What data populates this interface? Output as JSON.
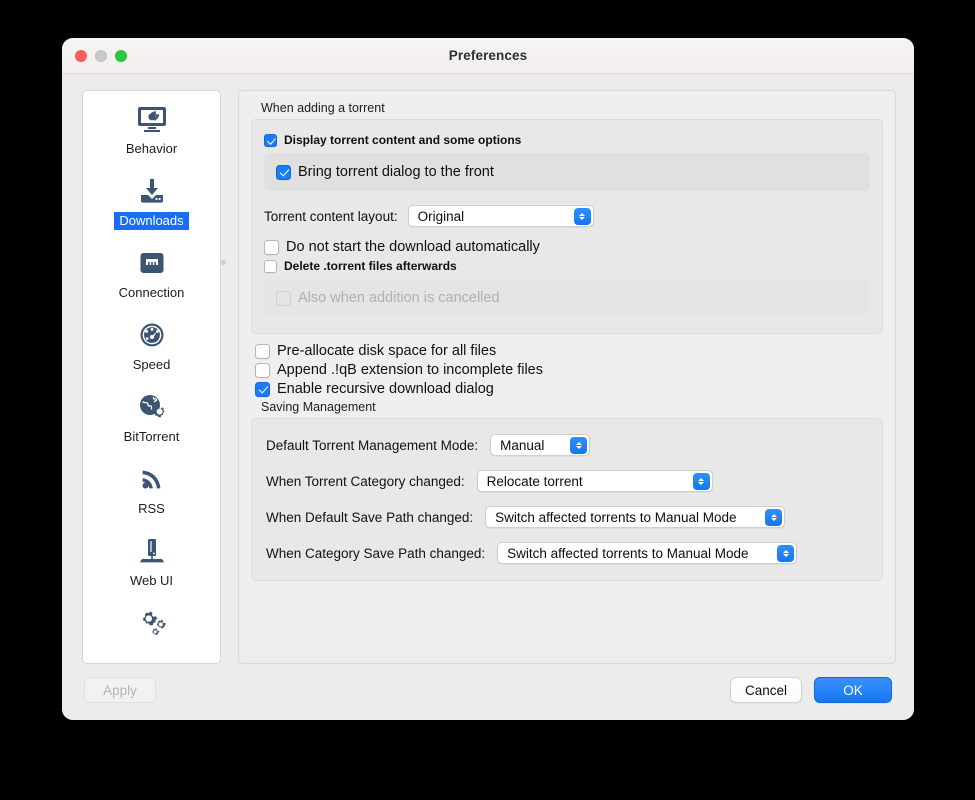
{
  "window": {
    "title": "Preferences",
    "traffic_lights": [
      "close-red",
      "minimize-gray",
      "zoom-green"
    ]
  },
  "sidebar": {
    "items": [
      {
        "label": "Behavior",
        "icon": "monitor-gear-icon",
        "selected": false
      },
      {
        "label": "Downloads",
        "icon": "download-arrow-icon",
        "selected": true
      },
      {
        "label": "Connection",
        "icon": "ethernet-port-icon",
        "selected": false
      },
      {
        "label": "Speed",
        "icon": "speedometer-icon",
        "selected": false
      },
      {
        "label": "BitTorrent",
        "icon": "globe-gear-icon",
        "selected": false
      },
      {
        "label": "RSS",
        "icon": "rss-waves-icon",
        "selected": false
      },
      {
        "label": "Web UI",
        "icon": "server-rack-icon",
        "selected": false
      },
      {
        "label": "",
        "icon": "gears-icon",
        "selected": false
      }
    ]
  },
  "content": {
    "adding_group": {
      "title": "When adding a torrent",
      "display_content": {
        "label": "Display torrent content and some options",
        "checked": true
      },
      "bring_front": {
        "label": "Bring torrent dialog to the front",
        "checked": true
      },
      "layout": {
        "label": "Torrent content layout:",
        "value": "Original"
      },
      "do_not_start": {
        "label": "Do not start the download automatically",
        "checked": false
      },
      "delete_torrent": {
        "label": "Delete .torrent files afterwards",
        "checked": false
      },
      "also_cancelled": {
        "label": "Also when addition is cancelled",
        "checked": false,
        "disabled": true
      }
    },
    "standalone_checkboxes": [
      {
        "label": "Pre-allocate disk space for all files",
        "checked": false
      },
      {
        "label": "Append .!qB extension to incomplete files",
        "checked": false
      },
      {
        "label": "Enable recursive download dialog",
        "checked": true
      }
    ],
    "saving_group": {
      "title": "Saving Management",
      "rows": [
        {
          "label": "Default Torrent Management Mode:",
          "value": "Manual",
          "width": "tmm"
        },
        {
          "label": "When Torrent Category changed:",
          "value": "Relocate torrent",
          "width": "cat"
        },
        {
          "label": "When Default Save Path changed:",
          "value": "Switch affected torrents to Manual Mode",
          "width": "path"
        },
        {
          "label": "When Category Save Path changed:",
          "value": "Switch affected torrents to Manual Mode",
          "width": "path"
        }
      ]
    }
  },
  "footer": {
    "apply": {
      "label": "Apply",
      "disabled": true
    },
    "cancel": {
      "label": "Cancel"
    },
    "ok": {
      "label": "OK"
    }
  },
  "colors": {
    "accent_blue": "#1a7cf7",
    "selection_blue": "#1a6ef5",
    "icon_navy": "#3c5572",
    "window_bg": "#ececec"
  }
}
